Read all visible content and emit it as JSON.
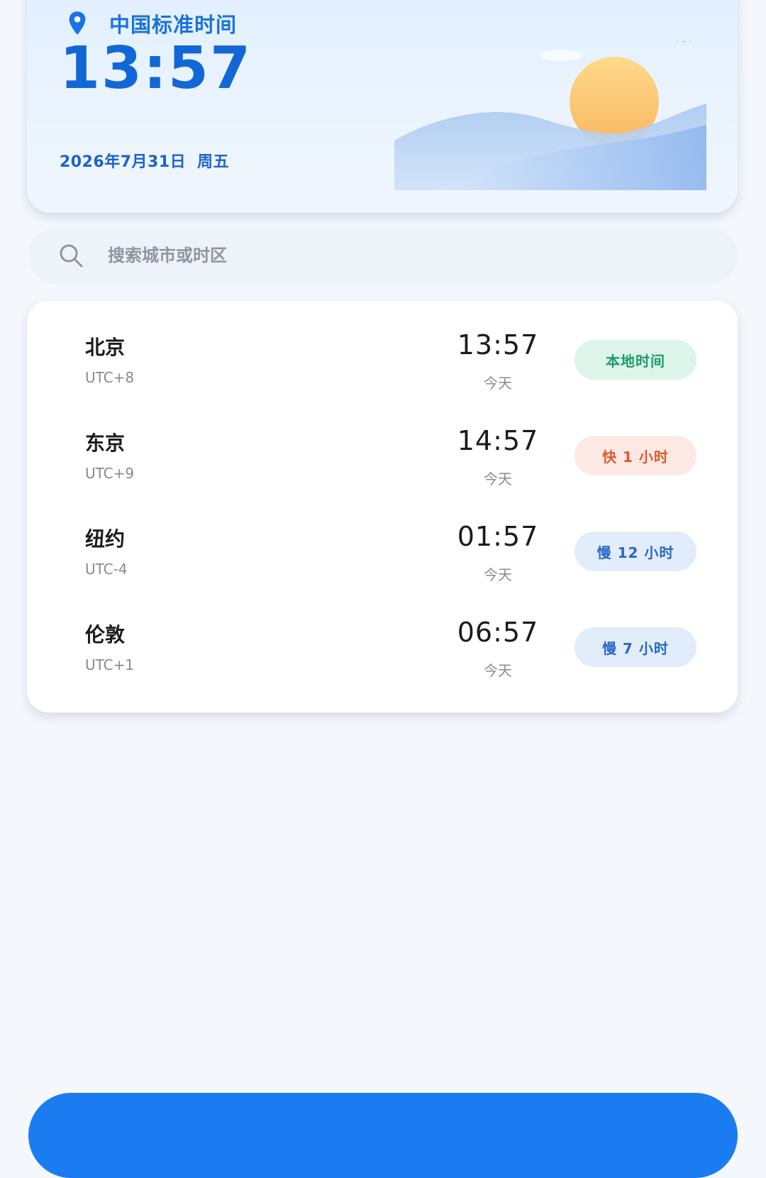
{
  "header": {
    "zone_title": "中国标准时间",
    "time": "13:57",
    "date": "2026年7月31日",
    "weekday": "周五"
  },
  "search": {
    "placeholder": "搜索城市或时区",
    "value": ""
  },
  "cities": [
    {
      "name": "北京",
      "offset": "UTC+8",
      "time": "13:57",
      "day": "今天",
      "badge": "本地时间",
      "badge_type": "local"
    },
    {
      "name": "东京",
      "offset": "UTC+9",
      "time": "14:57",
      "day": "今天",
      "badge": "快 1 小时",
      "badge_type": "ahead"
    },
    {
      "name": "纽约",
      "offset": "UTC-4",
      "time": "01:57",
      "day": "今天",
      "badge": "慢 12 小时",
      "badge_type": "behind"
    },
    {
      "name": "伦敦",
      "offset": "UTC+1",
      "time": "06:57",
      "day": "今天",
      "badge": "慢 7 小时",
      "badge_type": "behind"
    }
  ],
  "icons": {
    "location": "location-pin-icon",
    "search": "search-icon",
    "illustration": "sunrise-mountains-illustration"
  },
  "colors": {
    "accent": "#1267d6",
    "local_badge_bg": "#dcf4ea",
    "local_badge_text": "#1f9a6a",
    "ahead_badge_bg": "#fde9e3",
    "ahead_badge_text": "#dc5b2f",
    "behind_badge_bg": "#e2edfb",
    "behind_badge_text": "#2a68c4",
    "primary_button": "#1a7cf0"
  }
}
